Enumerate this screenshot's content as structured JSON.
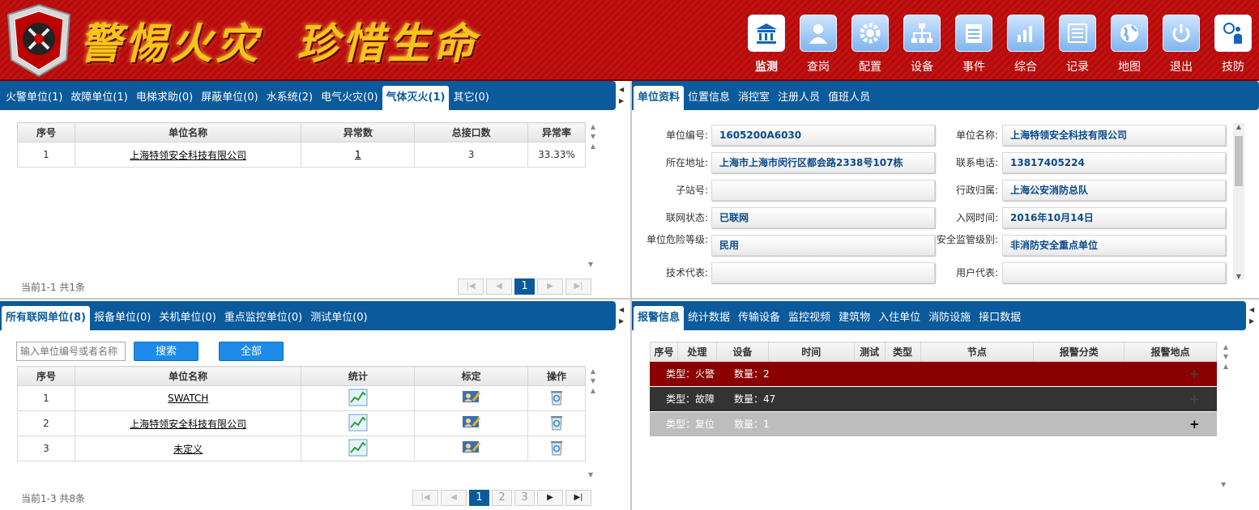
{
  "header": {
    "slogan": "警惕火灾  珍惜生命",
    "nav": [
      {
        "label": "监测",
        "icon": "building-icon"
      },
      {
        "label": "查岗",
        "icon": "person-icon"
      },
      {
        "label": "配置",
        "icon": "gear-icon"
      },
      {
        "label": "设备",
        "icon": "hierarchy-icon"
      },
      {
        "label": "事件",
        "icon": "notepad-icon"
      },
      {
        "label": "综合",
        "icon": "bar-chart-icon"
      },
      {
        "label": "记录",
        "icon": "list-icon"
      },
      {
        "label": "地图",
        "icon": "globe-icon"
      },
      {
        "label": "退出",
        "icon": "power-icon"
      },
      {
        "label": "技防",
        "icon": "magnifier-person-icon"
      }
    ]
  },
  "abnormal": {
    "tabs": [
      "火警单位(1)",
      "故障单位(1)",
      "电梯求助(0)",
      "屏蔽单位(0)",
      "水系统(2)",
      "电气火灾(0)",
      "气体灭火(1)",
      "其它(0)"
    ],
    "columns": [
      "序号",
      "单位名称",
      "异常数",
      "总接口数",
      "异常率"
    ],
    "rows": [
      {
        "no": "1",
        "name": "上海特领安全科技有限公司",
        "abnormal": "1",
        "total": "3",
        "rate": "33.33%"
      }
    ],
    "page_info": "当前1-1 共1条",
    "current_page": "1"
  },
  "networked": {
    "tabs": [
      "所有联网单位(8)",
      "报备单位(0)",
      "关机单位(0)",
      "重点监控单位(0)",
      "测试单位(0)"
    ],
    "search_placeholder": "输入单位编号或者名称",
    "search_label": "搜索",
    "all_label": "全部",
    "columns": [
      "序号",
      "单位名称",
      "统计",
      "标定",
      "操作"
    ],
    "rows": [
      {
        "no": "1",
        "name": "SWATCH"
      },
      {
        "no": "2",
        "name": "上海特领安全科技有限公司"
      },
      {
        "no": "3",
        "name": "未定义"
      }
    ],
    "page_info": "当前1-3 共8条",
    "pages": [
      "1",
      "2",
      "3"
    ]
  },
  "unit_info": {
    "tabs": [
      "单位资料",
      "位置信息",
      "消控室",
      "注册人员",
      "值班人员"
    ],
    "fields": [
      {
        "label": "单位编号:",
        "value": "1605200A6030"
      },
      {
        "label": "单位名称:",
        "value": "上海特领安全科技有限公司"
      },
      {
        "label": "所在地址:",
        "value": "上海市上海市闵行区都会路2338号107栋"
      },
      {
        "label": "联系电话:",
        "value": "13817405224"
      },
      {
        "label": "子站号:",
        "value": ""
      },
      {
        "label": "行政归属:",
        "value": "上海公安消防总队"
      },
      {
        "label": "联网状态:",
        "value": "已联网"
      },
      {
        "label": "入网时间:",
        "value": "2016年10月14日"
      },
      {
        "label": "单位危险等级:",
        "value": "民用"
      },
      {
        "label": "安全监管级别:",
        "value": "非消防安全重点单位"
      },
      {
        "label": "技术代表:",
        "value": ""
      },
      {
        "label": "用户代表:",
        "value": ""
      }
    ]
  },
  "alarms": {
    "tabs": [
      "报警信息",
      "统计数据",
      "传输设备",
      "监控视频",
      "建筑物",
      "入住单位",
      "消防设施",
      "接口数据"
    ],
    "columns": [
      "序号",
      "处理",
      "设备",
      "时间",
      "测试",
      "类型",
      "节点",
      "报警分类",
      "报警地点"
    ],
    "groups": [
      {
        "type_label": "类型：",
        "type": "火警",
        "count_label": "数量：",
        "count": "2",
        "color": "#8b0000"
      },
      {
        "type_label": "类型：",
        "type": "故障",
        "count_label": "数量：",
        "count": "47",
        "color": "#333333"
      },
      {
        "type_label": "类型：",
        "type": "复位",
        "count_label": "数量：",
        "count": "1",
        "color": "#bdbdbd"
      }
    ],
    "expand_glyph": "+"
  }
}
